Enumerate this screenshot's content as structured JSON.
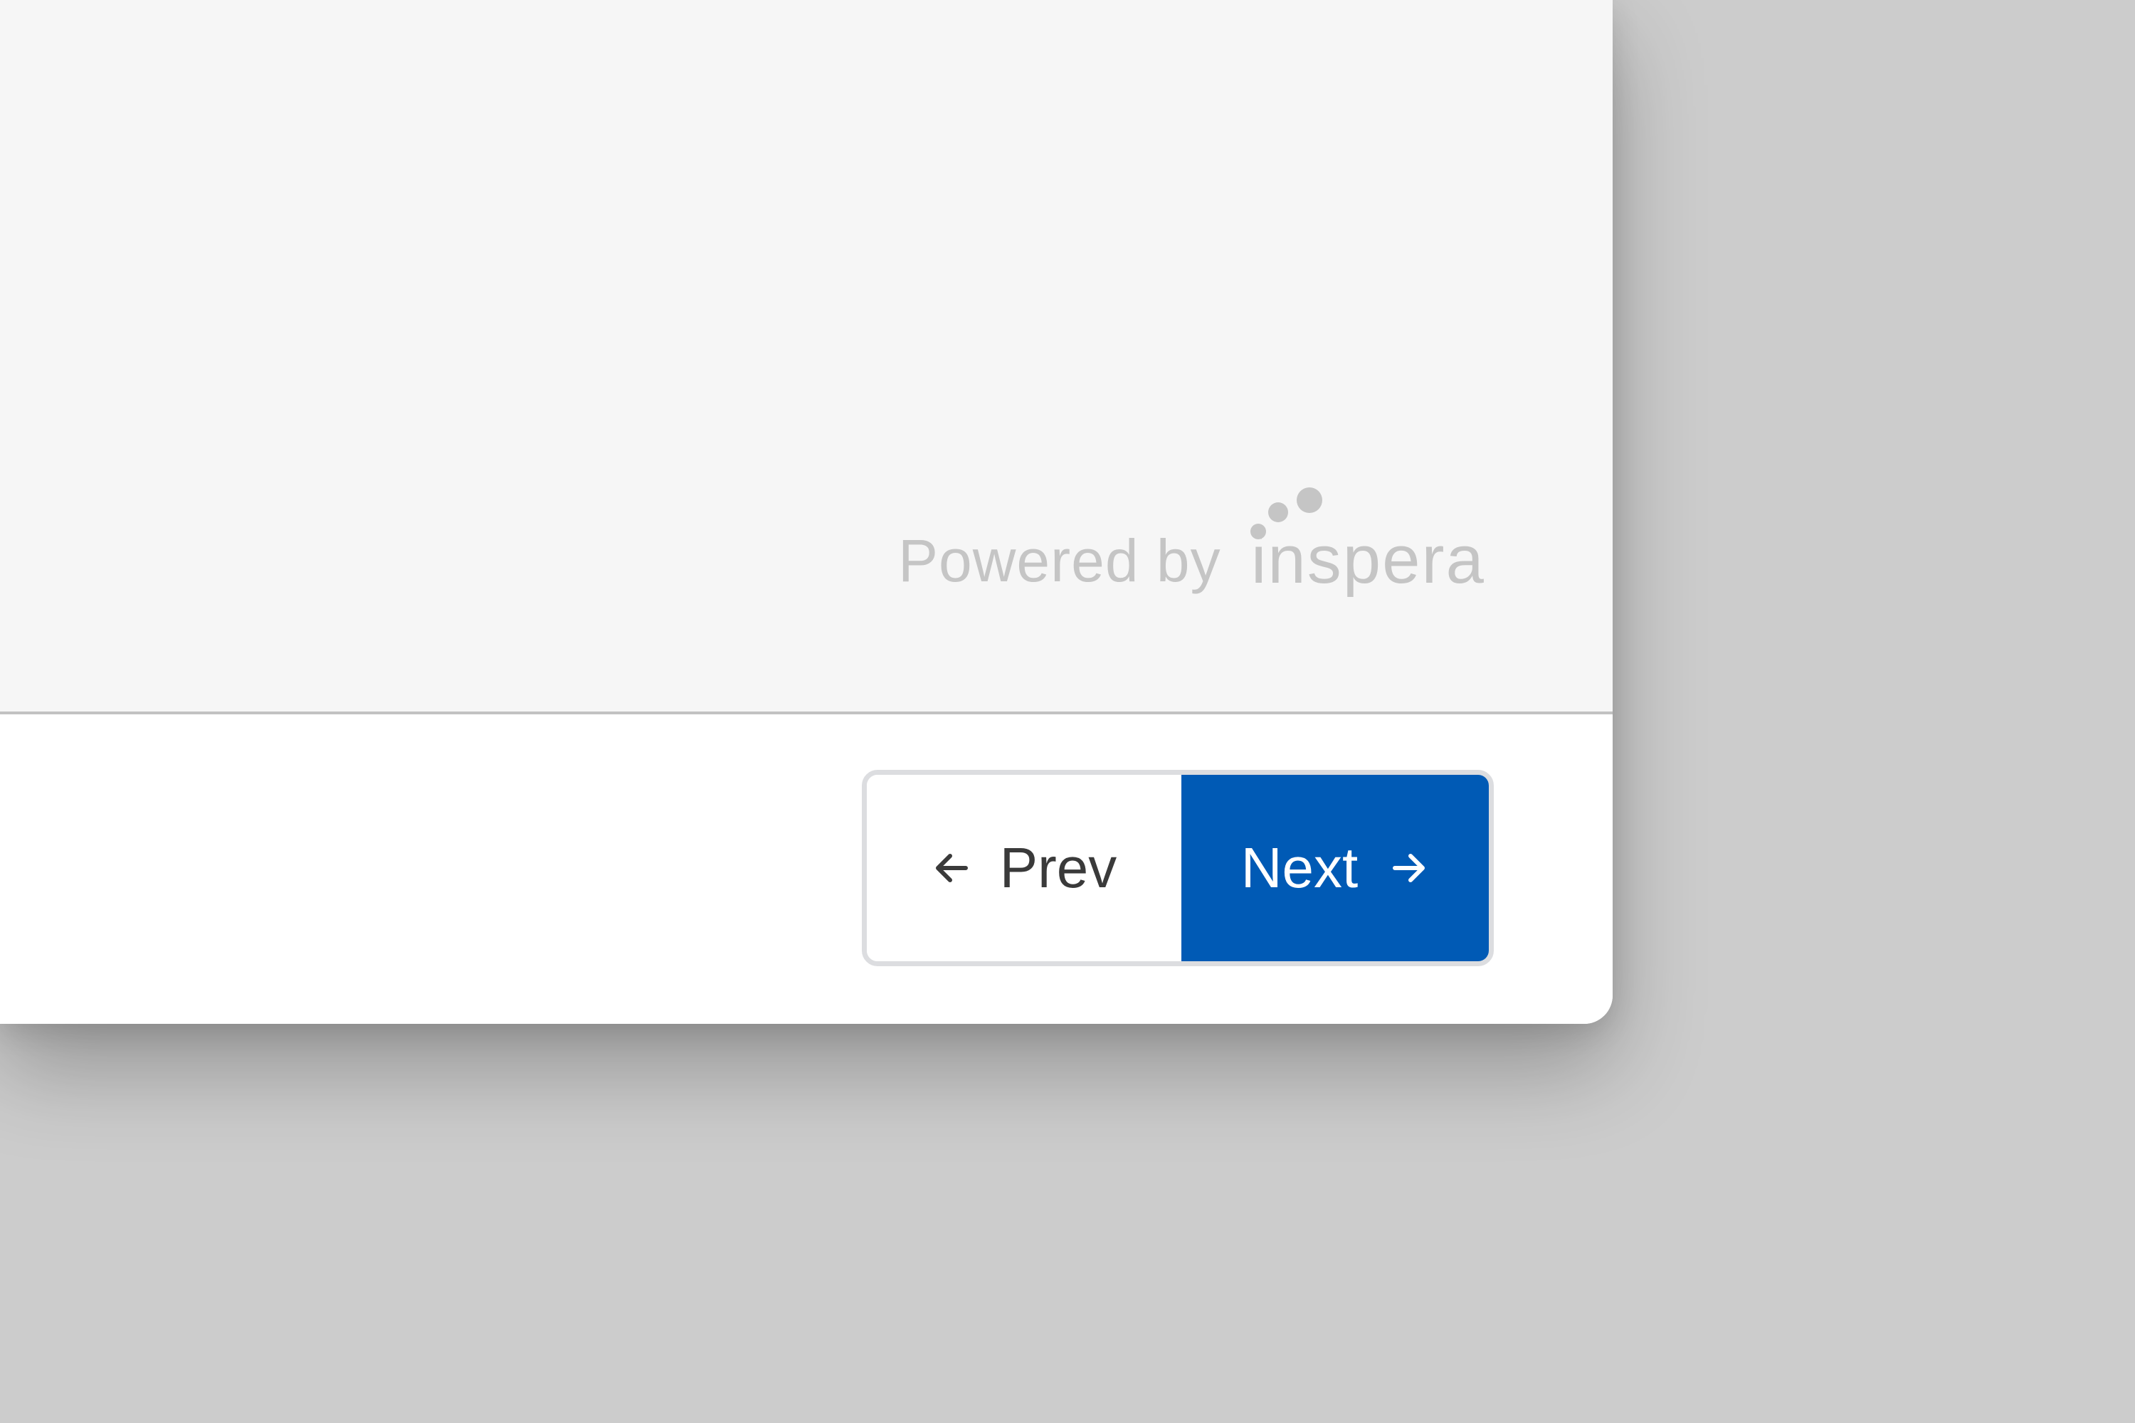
{
  "footer_branding": {
    "powered_by": "Powered by",
    "brand_name": "inspera",
    "logo_icon": "inspera-dots-icon"
  },
  "navigation": {
    "prev_label": "Prev",
    "prev_icon": "arrow-left-icon",
    "next_label": "Next",
    "next_icon": "arrow-right-icon"
  },
  "colors": {
    "next_button_bg": "#005ab5",
    "content_bg": "#f6f6f6",
    "branding_text": "#c5c5c5",
    "backdrop": "#cccccc"
  }
}
